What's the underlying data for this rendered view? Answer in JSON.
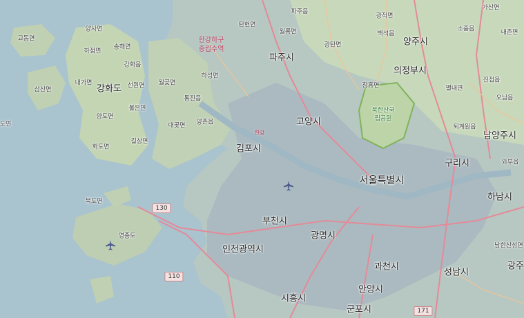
{
  "map": {
    "type": "street map",
    "region": "",
    "colors": {
      "sea": "#a9c3cf",
      "land": "#b7c7c2",
      "green_land": "#c4d7b5",
      "urban": "#aebcc4",
      "major_road": "#e48a98",
      "secondary_road": "#ecc59a",
      "park_boundary": "#88b66a"
    }
  },
  "labels": {
    "cities": [
      {
        "id": "seoul",
        "text": "서울특별시",
        "icon": "city-label"
      },
      {
        "id": "goyang",
        "text": "고양시",
        "icon": "city-label"
      },
      {
        "id": "paju",
        "text": "파주시",
        "icon": "city-label"
      },
      {
        "id": "uijeongbu",
        "text": "의정부시",
        "icon": "city-label"
      },
      {
        "id": "yangju",
        "text": "양주시",
        "icon": "city-label"
      },
      {
        "id": "gimpo",
        "text": "김포시",
        "icon": "city-label"
      },
      {
        "id": "bucheon",
        "text": "부천시",
        "icon": "city-label"
      },
      {
        "id": "incheon",
        "text": "인천광역시",
        "icon": "city-label"
      },
      {
        "id": "gwangmyeong",
        "text": "광명시",
        "icon": "city-label"
      },
      {
        "id": "gwacheon",
        "text": "과천시",
        "icon": "city-label"
      },
      {
        "id": "anyang",
        "text": "안양시",
        "icon": "city-label"
      },
      {
        "id": "siheung",
        "text": "시흥시",
        "icon": "city-label"
      },
      {
        "id": "gunpo",
        "text": "군포시",
        "icon": "city-label"
      },
      {
        "id": "seongnam",
        "text": "성남시",
        "icon": "city-label"
      },
      {
        "id": "hanam",
        "text": "하남시",
        "icon": "city-label"
      },
      {
        "id": "guri",
        "text": "구리시",
        "icon": "city-label"
      },
      {
        "id": "namyangju",
        "text": "남양주시",
        "icon": "city-label"
      },
      {
        "id": "gwangju",
        "text": "광주",
        "icon": "city-label"
      },
      {
        "id": "ganghwa",
        "text": "강화도",
        "icon": "city-label"
      }
    ],
    "towns": [
      {
        "id": "gyodong",
        "text": "교동면"
      },
      {
        "id": "yangsa",
        "text": "양사면"
      },
      {
        "id": "hajeom",
        "text": "하점면"
      },
      {
        "id": "songhae",
        "text": "송해면"
      },
      {
        "id": "ganghwaeup",
        "text": "강화읍"
      },
      {
        "id": "naega",
        "text": "내가면"
      },
      {
        "id": "seonwon",
        "text": "선원면"
      },
      {
        "id": "wolgot",
        "text": "월곶면"
      },
      {
        "id": "samsan",
        "text": "삼산면"
      },
      {
        "id": "yangdo",
        "text": "양도면"
      },
      {
        "id": "bureun",
        "text": "불은면"
      },
      {
        "id": "hwado",
        "text": "화도면"
      },
      {
        "id": "gilsang",
        "text": "길상면"
      },
      {
        "id": "daegot",
        "text": "대곶면"
      },
      {
        "id": "yangchon",
        "text": "양촌읍"
      },
      {
        "id": "haseong",
        "text": "하성면"
      },
      {
        "id": "tongjin",
        "text": "통진읍"
      },
      {
        "id": "do",
        "text": "도면"
      },
      {
        "id": "bukdo",
        "text": "북도면"
      },
      {
        "id": "yeongjong",
        "text": "영종도"
      },
      {
        "id": "tanhyeon",
        "text": "탄현면"
      },
      {
        "id": "wollong",
        "text": "월롱면"
      },
      {
        "id": "paju_eup",
        "text": "파주읍"
      },
      {
        "id": "gwangtan",
        "text": "광탄면"
      },
      {
        "id": "gwangjeok",
        "text": "광적면"
      },
      {
        "id": "baekseok",
        "text": "백석읍"
      },
      {
        "id": "jangheung",
        "text": "장흥면"
      },
      {
        "id": "soheul",
        "text": "소흘읍"
      },
      {
        "id": "gasan",
        "text": "가산면"
      },
      {
        "id": "naechon",
        "text": "내촌면"
      },
      {
        "id": "byeollae",
        "text": "별내면"
      },
      {
        "id": "jinjeop",
        "text": "진접읍"
      },
      {
        "id": "onam",
        "text": "오남읍"
      },
      {
        "id": "toegyewon",
        "text": "퇴계원읍"
      },
      {
        "id": "wabu",
        "text": "와부읍"
      },
      {
        "id": "namhansanseong",
        "text": "남한산성면"
      }
    ],
    "water": [
      {
        "id": "estuary",
        "text": "한강하구\n중립수역"
      },
      {
        "id": "hangang",
        "text": "한강"
      }
    ],
    "parks": [
      {
        "id": "bukhansan",
        "text": "북한산국\n립공원"
      }
    ],
    "routes": [
      {
        "id": "r130",
        "text": "130"
      },
      {
        "id": "r110",
        "text": "110"
      },
      {
        "id": "r171",
        "text": "171"
      }
    ],
    "airports": [
      {
        "id": "incheon-airport",
        "icon": "airport-icon"
      },
      {
        "id": "gimpo-airport",
        "icon": "airport-icon"
      }
    ]
  }
}
